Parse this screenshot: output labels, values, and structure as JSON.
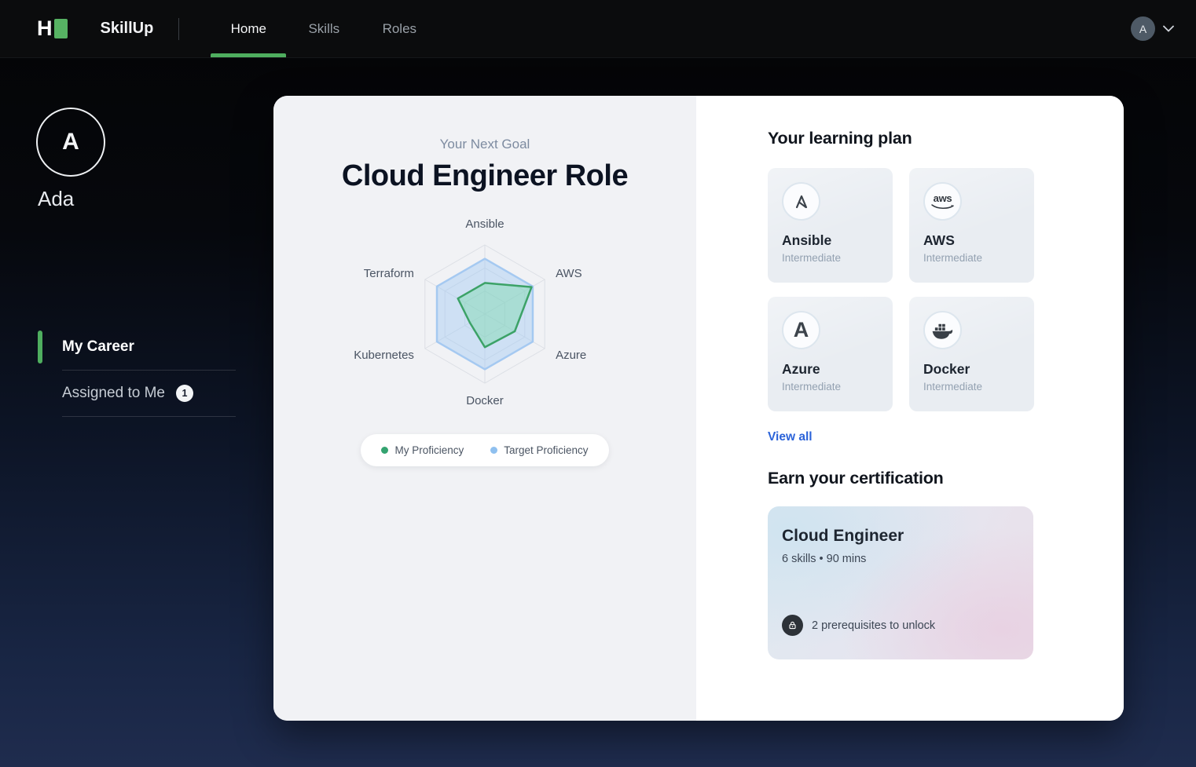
{
  "nav": {
    "brand": "SkillUp",
    "logo_letter": "H",
    "items": [
      {
        "label": "Home",
        "active": true
      },
      {
        "label": "Skills",
        "active": false
      },
      {
        "label": "Roles",
        "active": false
      }
    ],
    "avatar_initial": "A"
  },
  "sidebar": {
    "avatar_initial": "A",
    "user_name": "Ada",
    "items": [
      {
        "label": "My Career",
        "active": true
      },
      {
        "label": "Assigned to Me",
        "badge": "1"
      }
    ]
  },
  "goal": {
    "eyebrow": "Your Next Goal",
    "title": "Cloud Engineer Role"
  },
  "chart_data": {
    "type": "radar",
    "title": "Cloud Engineer Role skill radar",
    "categories": [
      "Ansible",
      "AWS",
      "Azure",
      "Docker",
      "Kubernetes",
      "Terraform"
    ],
    "max": 100,
    "grid_levels": 3,
    "grid_color": "#dcdfe5",
    "label_color": "#4a5463",
    "legend_position": "bottom",
    "series": [
      {
        "name": "My Proficiency",
        "values": [
          45,
          78,
          50,
          48,
          25,
          45
        ],
        "stroke": "#3ca267",
        "fill": "rgba(120,216,168,0.42)",
        "dot": "#34a370"
      },
      {
        "name": "Target Proficiency",
        "values": [
          80,
          80,
          80,
          80,
          80,
          80
        ],
        "stroke": "#a5c9f1",
        "fill": "rgba(158,199,242,0.42)",
        "dot": "#8fc0ef"
      }
    ]
  },
  "learning_plan": {
    "title": "Your learning plan",
    "cards": [
      {
        "name": "Ansible",
        "level": "Intermediate"
      },
      {
        "name": "AWS",
        "level": "Intermediate"
      },
      {
        "name": "Azure",
        "level": "Intermediate"
      },
      {
        "name": "Docker",
        "level": "Intermediate"
      }
    ],
    "view_all": "View all",
    "aws_word": "aws",
    "azure_letter": "A"
  },
  "certification": {
    "title": "Earn your certification",
    "card": {
      "name": "Cloud Engineer",
      "meta": "6 skills • 90 mins",
      "lock_text": "2 prerequisites to unlock"
    }
  },
  "colors": {
    "accent_green": "#4fae5f",
    "link_blue": "#2b63d9",
    "nav_bg": "#0b0c0d",
    "page_bottom": "#1f2c4e"
  }
}
